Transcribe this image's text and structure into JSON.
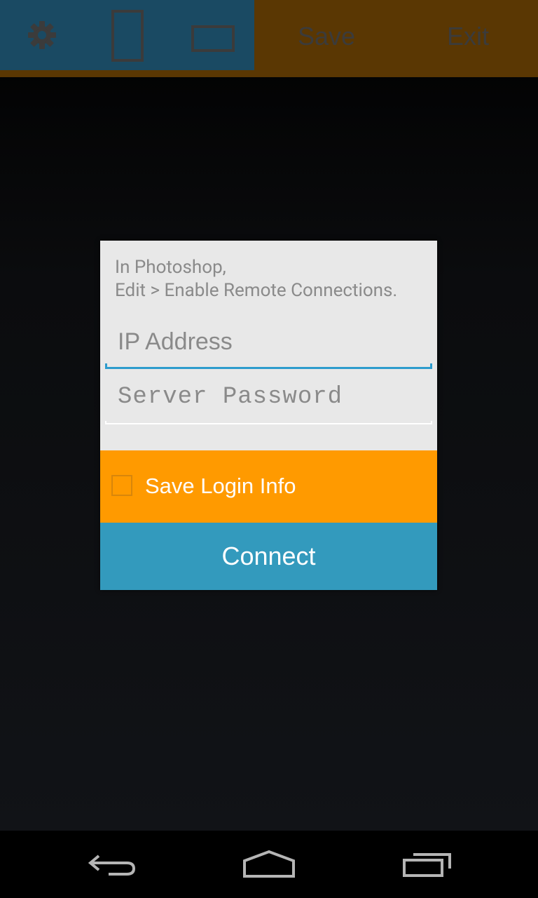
{
  "toolbar": {
    "icons": [
      "gear-icon",
      "portrait-icon",
      "landscape-icon"
    ],
    "save_label": "Save",
    "exit_label": "Exit"
  },
  "dialog": {
    "instructions_line1": "In Photoshop,",
    "instructions_line2": "Edit > Enable Remote Connections.",
    "ip_placeholder": "IP Address",
    "ip_value": "",
    "password_placeholder": "Server Password",
    "password_value": "",
    "save_login_label": "Save Login Info",
    "save_login_checked": false,
    "connect_label": "Connect"
  },
  "navbar": {
    "icons": [
      "back-icon",
      "home-icon",
      "recent-apps-icon"
    ]
  },
  "colors": {
    "toolbar_left": "#1a4a63",
    "toolbar_right": "#5a3703",
    "input_focus": "#2e9ccd",
    "save_row": "#ff9a00",
    "connect_button": "#339abd"
  }
}
